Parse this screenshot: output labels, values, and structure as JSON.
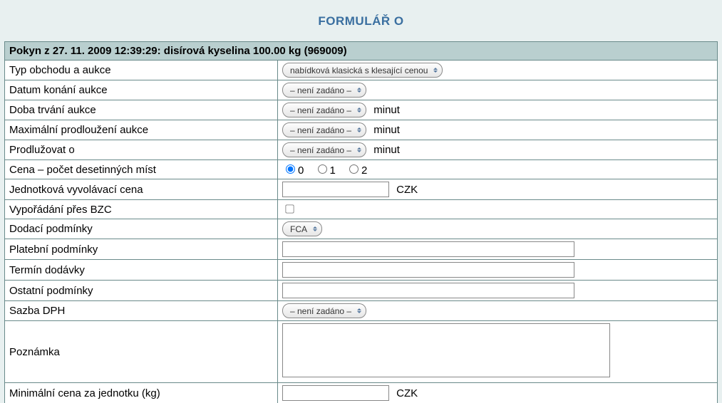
{
  "title": "FORMULÁŘ O",
  "header": "Pokyn z 27. 11. 2009 12:39:29: disírová kyselina 100.00 kg (969009)",
  "rows": {
    "trade_type": {
      "label": "Typ obchodu a aukce",
      "select_value": "nabídková klasická s klesající cenou"
    },
    "auction_date": {
      "label": "Datum konání aukce",
      "select_value": "– není zadáno –"
    },
    "auction_duration": {
      "label": "Doba trvání aukce",
      "select_value": "– není zadáno –",
      "unit": "minut"
    },
    "max_extension": {
      "label": "Maximální prodloužení aukce",
      "select_value": "– není zadáno –",
      "unit": "minut"
    },
    "extend_by": {
      "label": "Prodlužovat o",
      "select_value": "– není zadáno –",
      "unit": "minut"
    },
    "decimals": {
      "label": "Cena – počet desetinných míst",
      "opt0": "0",
      "opt1": "1",
      "opt2": "2"
    },
    "start_price": {
      "label": "Jednotková vyvolávací cena",
      "value": "",
      "currency": "CZK"
    },
    "bzc": {
      "label": "Vypořádání přes BZC",
      "checked": false
    },
    "delivery_terms": {
      "label": "Dodací podmínky",
      "select_value": "FCA"
    },
    "payment_terms": {
      "label": "Platební podmínky",
      "value": ""
    },
    "delivery_date": {
      "label": "Termín dodávky",
      "value": ""
    },
    "other_terms": {
      "label": "Ostatní podmínky",
      "value": ""
    },
    "vat": {
      "label": "Sazba DPH",
      "select_value": "– není zadáno –"
    },
    "note": {
      "label": "Poznámka",
      "value": ""
    },
    "min_price": {
      "label": "Minimální cena za jednotku (kg)",
      "value": "",
      "currency": "CZK"
    }
  }
}
